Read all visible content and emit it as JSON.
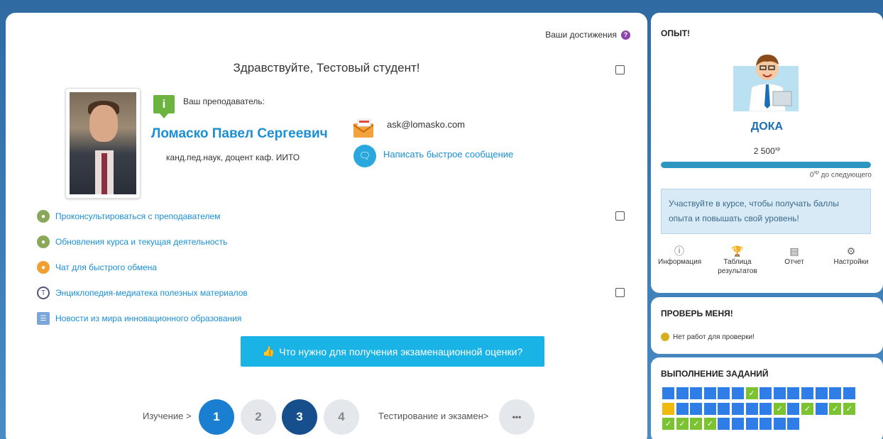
{
  "header": {
    "achievements_label": "Ваши достижения",
    "help_icon": "?"
  },
  "main": {
    "greeting": "Здравствуйте, Тестовый студент!",
    "teacher_label": "Ваш преподаватель:",
    "info_badge": "i",
    "teacher_name": "Ломаско Павел Сергеевич",
    "teacher_title": "канд.пед.наук, доцент каф. ИИТО",
    "email": "ask@lomasko.com",
    "quick_message": "Написать быстрое сообщение",
    "activities": [
      {
        "label": "Проконсультироваться с преподавателем",
        "icon": "forum-icon"
      },
      {
        "label": "Обновления курса и текущая деятельность",
        "icon": "forum-icon"
      },
      {
        "label": "Чат для быстрого обмена",
        "icon": "chat-icon"
      },
      {
        "label": "Энциклопедия-медиатека полезных материалов",
        "icon": "glossary-icon"
      },
      {
        "label": "Новости из мира инновационного образования",
        "icon": "page-icon"
      }
    ],
    "exam_button": "Что нужно для получения экзаменационной оценки?",
    "pager": {
      "study_label": "Изучение >",
      "pages": [
        "1",
        "2",
        "3",
        "4"
      ],
      "testing_label": "Тестирование и экзамен>",
      "more": "•••"
    }
  },
  "experience": {
    "title": "ОПЫТ!",
    "level_name": "ДОКА",
    "points": "2 500",
    "points_unit": "xp",
    "progress_fraction": 1.0,
    "next_points": "0",
    "next_unit": "xp",
    "next_label": "до следующего",
    "notice": "Участвуйте в курсе, чтобы получать баллы опыта и повышать свой уровень!",
    "tools": [
      {
        "label": "Информация",
        "icon": "info-icon"
      },
      {
        "label": "Таблица результатов",
        "icon": "trophy-icon"
      },
      {
        "label": "Отчет",
        "icon": "report-icon"
      },
      {
        "label": "Настройки",
        "icon": "gear-icon"
      }
    ]
  },
  "review": {
    "title": "ПРОВЕРЬ МЕНЯ!",
    "message": "Нет работ для проверки!"
  },
  "tasks": {
    "title": "ВЫПОЛНЕНИЕ ЗАДАНИЙ",
    "rows": [
      [
        "todo",
        "todo",
        "todo",
        "todo",
        "todo",
        "todo",
        "done",
        "todo",
        "todo",
        "todo",
        "todo",
        "todo",
        "todo",
        "todo"
      ],
      [
        "cur",
        "todo",
        "todo",
        "todo",
        "todo",
        "todo",
        "todo",
        "todo",
        "done",
        "todo",
        "done",
        "todo",
        "done",
        "done"
      ],
      [
        "done",
        "done",
        "done",
        "done",
        "todo",
        "todo",
        "todo",
        "todo",
        "todo",
        "todo"
      ]
    ]
  },
  "colors": {
    "accent": "#1ab3e6",
    "link": "#1a8fd6",
    "task_todo": "#2f7de6",
    "task_done": "#7cc332",
    "task_current": "#f0b90b"
  }
}
